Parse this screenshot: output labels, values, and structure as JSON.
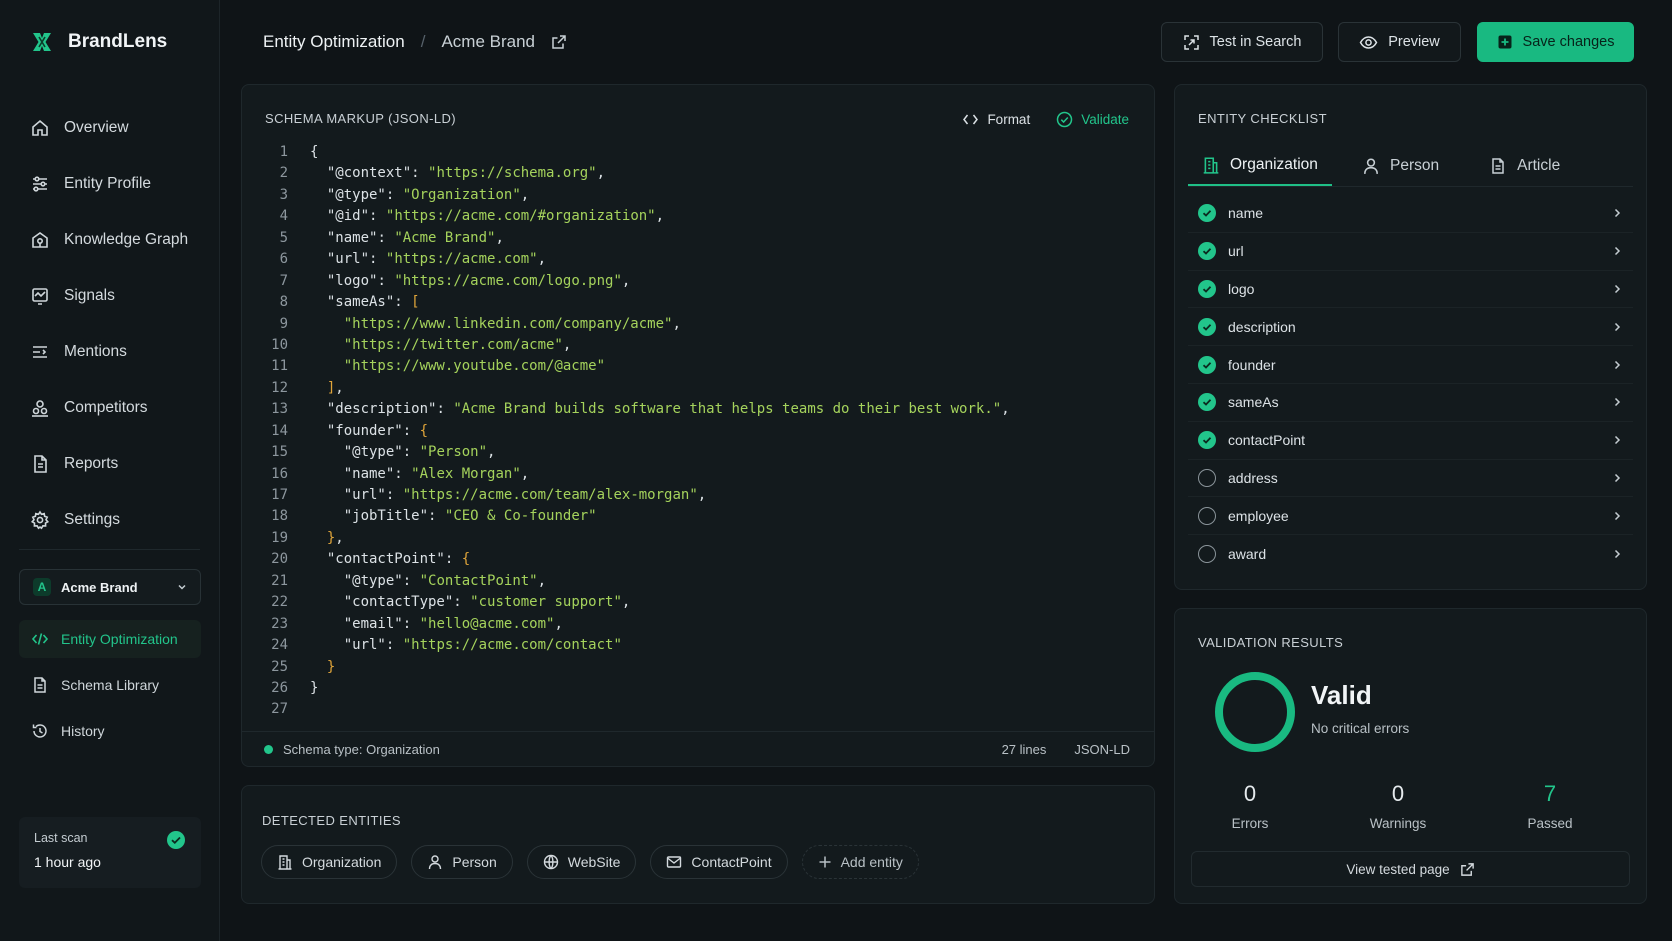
{
  "app": {
    "name": "BrandLens"
  },
  "nav": [
    {
      "label": "Overview",
      "icon": "home-icon"
    },
    {
      "label": "Entity Profile",
      "icon": "sliders-icon"
    },
    {
      "label": "Knowledge Graph",
      "icon": "graph-icon"
    },
    {
      "label": "Signals",
      "icon": "signal-icon"
    },
    {
      "label": "Mentions",
      "icon": "list-icon"
    },
    {
      "label": "Competitors",
      "icon": "users-icon"
    },
    {
      "label": "Reports",
      "icon": "report-icon"
    },
    {
      "label": "Settings",
      "icon": "gear-icon"
    }
  ],
  "brand_switcher": {
    "badge": "A",
    "label": "Acme Brand"
  },
  "sub_nav": [
    {
      "label": "Entity Optimization",
      "icon": "code-icon"
    },
    {
      "label": "Schema Library",
      "icon": "document-icon"
    },
    {
      "label": "History",
      "icon": "history-icon"
    }
  ],
  "last_scan": {
    "label": "Last scan",
    "value": "1 hour ago"
  },
  "breadcrumb": {
    "section": "Entity Optimization",
    "separator": "/",
    "page": "Acme Brand"
  },
  "header": {
    "test_label": "Test in Search",
    "preview_label": "Preview",
    "save_label": "Save changes"
  },
  "schema": {
    "title": "SCHEMA MARKUP (JSON-LD)",
    "format_label": "Format",
    "validate_label": "Validate",
    "lines": [
      "{",
      "  \"@context\": \"https://schema.org\",",
      "  \"@type\": \"Organization\",",
      "  \"@id\": \"https://acme.com/#organization\",",
      "  \"name\": \"Acme Brand\",",
      "  \"url\": \"https://acme.com\",",
      "  \"logo\": \"https://acme.com/logo.png\",",
      "  \"sameAs\": [",
      "    \"https://www.linkedin.com/company/acme\",",
      "    \"https://twitter.com/acme\",",
      "    \"https://www.youtube.com/@acme\"",
      "  ],",
      "  \"description\": \"Acme Brand builds software that helps teams do their best work.\",",
      "  \"founder\": {",
      "    \"@type\": \"Person\",",
      "    \"name\": \"Alex Morgan\",",
      "    \"url\": \"https://acme.com/team/alex-morgan\",",
      "    \"jobTitle\": \"CEO & Co-founder\"",
      "  },",
      "  \"contactPoint\": {",
      "    \"@type\": \"ContactPoint\",",
      "    \"contactType\": \"customer support\",",
      "    \"email\": \"hello@acme.com\",",
      "    \"url\": \"https://acme.com/contact\"",
      "  }",
      "}",
      ""
    ],
    "footer": {
      "type_label": "Schema type: Organization",
      "lines_label": "27 lines",
      "format": "JSON-LD"
    }
  },
  "detected": {
    "title": "DETECTED ENTITIES",
    "chips": [
      {
        "label": "Organization",
        "icon": "building-icon"
      },
      {
        "label": "Person",
        "icon": "user-icon"
      },
      {
        "label": "WebSite",
        "icon": "globe-icon"
      },
      {
        "label": "ContactPoint",
        "icon": "mail-icon"
      }
    ],
    "add_label": "Add entity"
  },
  "checklist": {
    "title": "ENTITY CHECKLIST",
    "tabs": [
      {
        "label": "Organization",
        "icon": "building-icon"
      },
      {
        "label": "Person",
        "icon": "user-icon"
      },
      {
        "label": "Article",
        "icon": "document-icon"
      }
    ],
    "items": [
      {
        "name": "name",
        "done": true
      },
      {
        "name": "url",
        "done": true
      },
      {
        "name": "logo",
        "done": true
      },
      {
        "name": "description",
        "done": true
      },
      {
        "name": "founder",
        "done": true
      },
      {
        "name": "sameAs",
        "done": true
      },
      {
        "name": "contactPoint",
        "done": true
      },
      {
        "name": "address",
        "done": false
      },
      {
        "name": "employee",
        "done": false
      },
      {
        "name": "award",
        "done": false
      }
    ]
  },
  "validation": {
    "title": "VALIDATION RESULTS",
    "status": "Valid",
    "subtitle": "No critical errors",
    "stats": [
      {
        "value": "0",
        "label": "Errors"
      },
      {
        "value": "0",
        "label": "Warnings"
      },
      {
        "value": "7",
        "label": "Passed"
      }
    ],
    "view_label": "View tested page"
  },
  "colors": {
    "accent": "#22c58b",
    "string": "#a5d35c",
    "bracket": "#e0a53a",
    "background": "#0f1417"
  }
}
